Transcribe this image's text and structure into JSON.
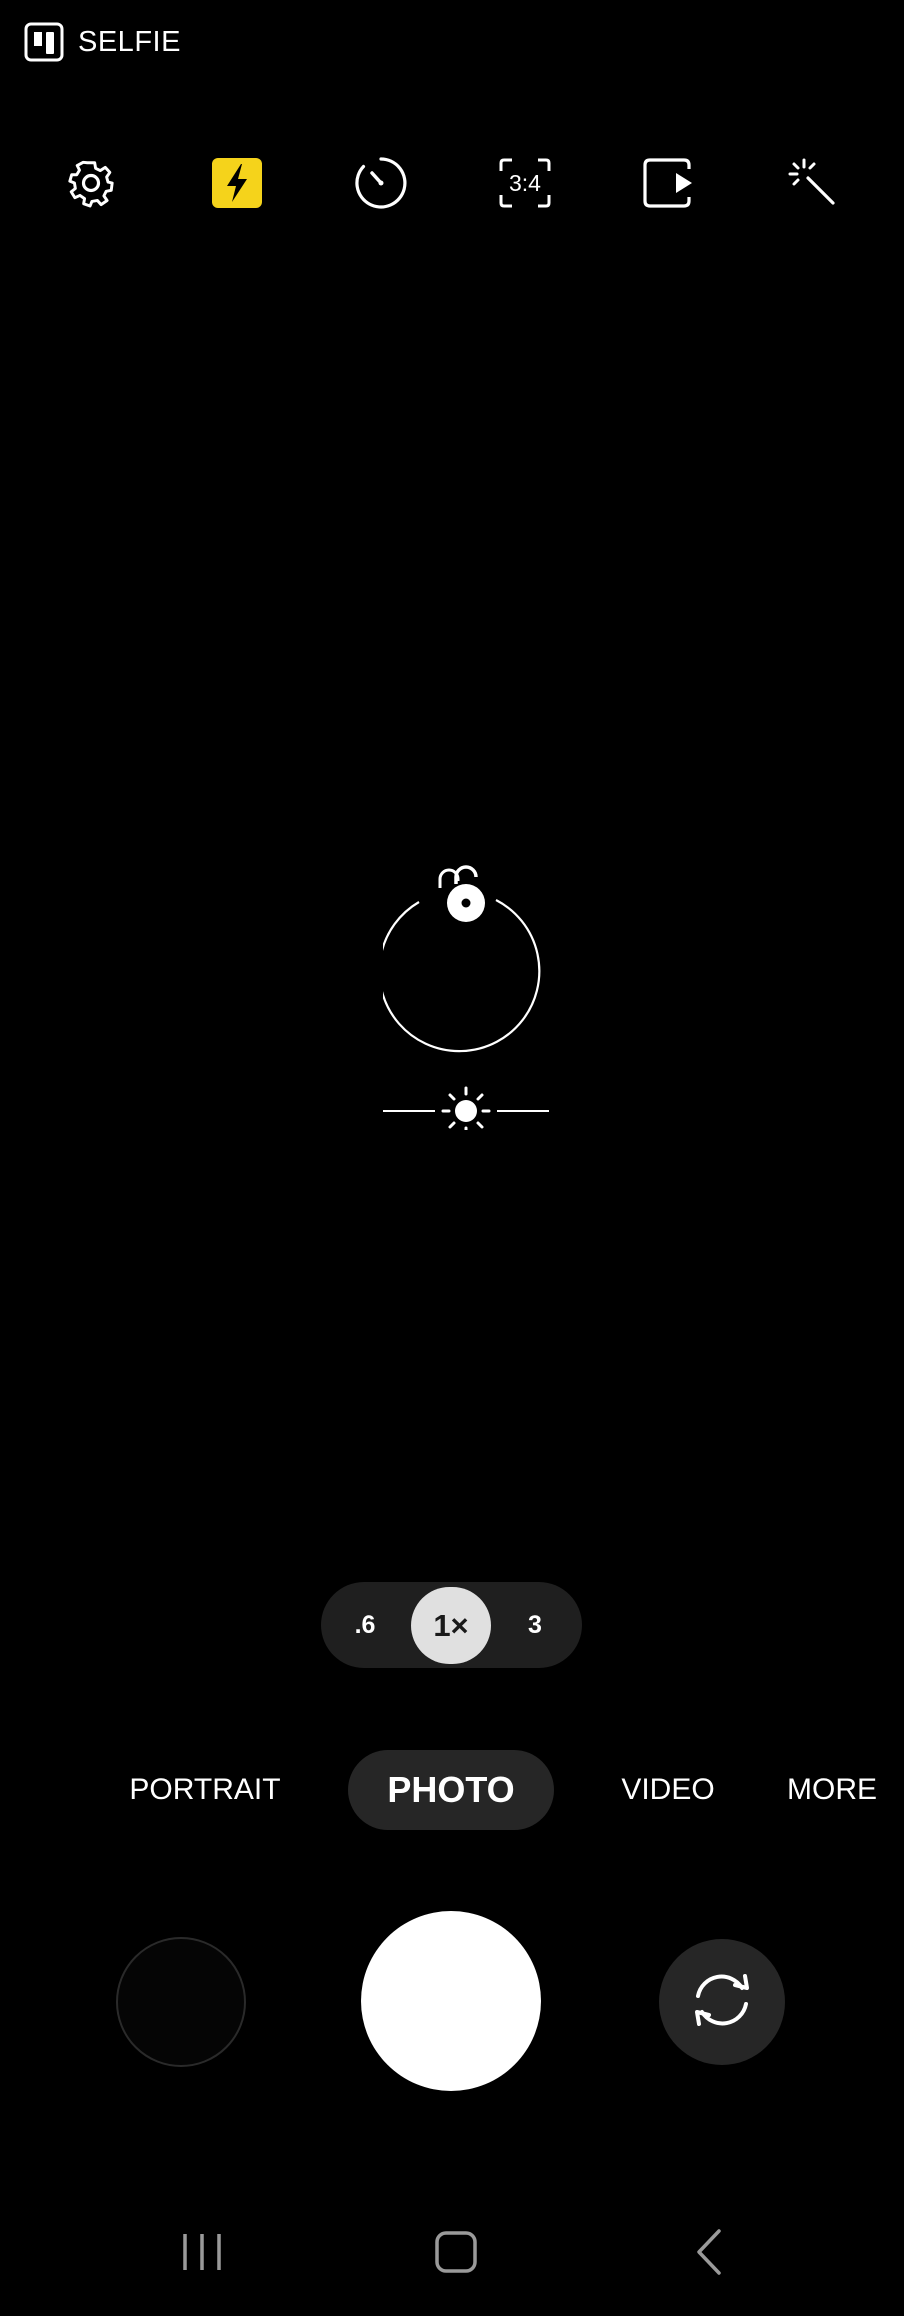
{
  "status": {
    "camera_label": "SELFIE",
    "camera_icon": "selfie-camera-icon"
  },
  "toolbar": {
    "items": [
      {
        "name": "settings",
        "icon": "gear-icon"
      },
      {
        "name": "flash",
        "icon": "flash-icon",
        "active": true,
        "active_color": "#f5d31b"
      },
      {
        "name": "timer",
        "icon": "timer-icon"
      },
      {
        "name": "aspect-ratio",
        "icon": "aspect-ratio-icon",
        "label": "3:4"
      },
      {
        "name": "motion-photo",
        "icon": "motion-photo-icon"
      },
      {
        "name": "effects",
        "icon": "magic-wand-icon"
      }
    ]
  },
  "focus": {
    "lock_icon": "unlock-icon",
    "brightness_icon": "brightness-sun-icon"
  },
  "zoom": {
    "options": [
      ".6",
      "1×",
      "3"
    ],
    "selected": "1×"
  },
  "modes": {
    "items": [
      "PORTRAIT",
      "PHOTO",
      "VIDEO",
      "MORE"
    ],
    "selected": "PHOTO"
  },
  "controls": {
    "gallery_icon": "gallery-thumbnail",
    "shutter_icon": "shutter-button",
    "switch_icon": "switch-camera-icon"
  },
  "navigation": {
    "items": [
      "recent-apps-icon",
      "home-icon",
      "back-icon"
    ]
  }
}
